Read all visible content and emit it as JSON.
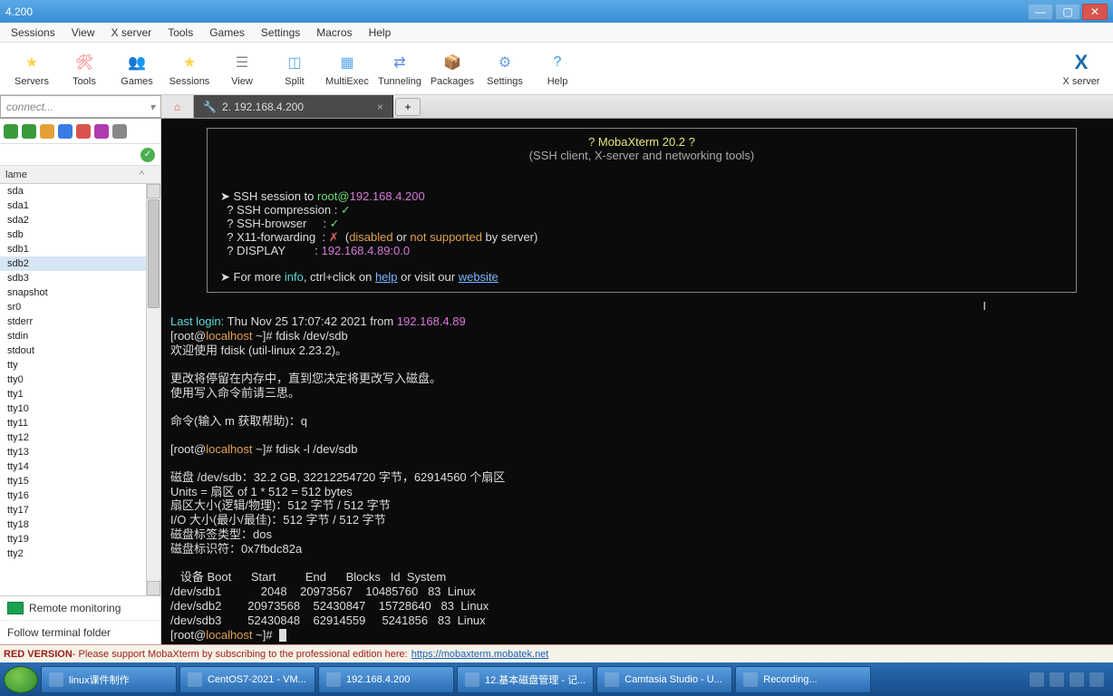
{
  "titlebar": {
    "title": "4.200"
  },
  "menubar": [
    "Sessions",
    "View",
    "X server",
    "Tools",
    "Games",
    "Settings",
    "Macros",
    "Help"
  ],
  "toolbar": [
    {
      "label": "Servers",
      "color": "#ffd24d",
      "glyph": "★"
    },
    {
      "label": "Tools",
      "color": "#ff5a5a",
      "glyph": "🛠"
    },
    {
      "label": "Games",
      "color": "#ffcf3a",
      "glyph": "👥"
    },
    {
      "label": "Sessions",
      "color": "#ffd24d",
      "glyph": "★"
    },
    {
      "label": "View",
      "color": "#8a8a8a",
      "glyph": "☰"
    },
    {
      "label": "Split",
      "color": "#5aa9e6",
      "glyph": "◫"
    },
    {
      "label": "MultiExec",
      "color": "#5aa9e6",
      "glyph": "▦"
    },
    {
      "label": "Tunneling",
      "color": "#5a8ae6",
      "glyph": "⇄"
    },
    {
      "label": "Packages",
      "color": "#c9a15a",
      "glyph": "📦"
    },
    {
      "label": "Settings",
      "color": "#6aa0e6",
      "glyph": "⚙"
    },
    {
      "label": "Help",
      "color": "#3a9be6",
      "glyph": "?"
    }
  ],
  "toolbar_right": {
    "label": "X server",
    "glyph": "✕"
  },
  "connect_placeholder": "connect...",
  "tabs": {
    "active": {
      "icon": "🔧",
      "label": "2. 192.168.4.200"
    },
    "add": "+"
  },
  "sidebar": {
    "header": "lame",
    "items": [
      "sda",
      "sda1",
      "sda2",
      "sdb",
      "sdb1",
      "sdb2",
      "sdb3",
      "snapshot",
      "sr0",
      "stderr",
      "stdin",
      "stdout",
      "tty",
      "tty0",
      "tty1",
      "tty10",
      "tty11",
      "tty12",
      "tty13",
      "tty14",
      "tty15",
      "tty16",
      "tty17",
      "tty18",
      "tty19",
      "tty2"
    ],
    "selected_index": 5,
    "remote_monitoring": "Remote monitoring",
    "follow": "Follow terminal folder"
  },
  "terminal": {
    "banner_title": "? MobaXterm 20.2 ?",
    "banner_sub": "(SSH client, X-server and networking tools)",
    "ssh_to_prefix": "➤ SSH session to ",
    "ssh_user": "root",
    "ssh_at": "@",
    "ssh_host": "192.168.4.200",
    "rows": [
      {
        "label": "SSH compression",
        "mark": "✓",
        "mark_color": "c-green"
      },
      {
        "label": "SSH-browser",
        "mark": "✓",
        "mark_color": "c-green"
      },
      {
        "label": "X11-forwarding",
        "mark": "✗",
        "mark_color": "c-red",
        "extra": "  (disabled or not supported by server)",
        "extra_parts": [
          [
            "(",
            ""
          ],
          [
            "disabled",
            "c-orange"
          ],
          [
            " or ",
            ""
          ],
          [
            "not supported",
            "c-orange"
          ],
          [
            " by server)",
            ""
          ]
        ]
      },
      {
        "label": "DISPLAY",
        "value": "192.168.4.89:0.0",
        "value_color": "c-magenta"
      }
    ],
    "more_prefix": "➤ For more ",
    "more_info": "info",
    "more_mid": ", ctrl+click on ",
    "more_help": "help",
    "more_or": " or visit our ",
    "more_site": "website",
    "last_login_label": "Last login:",
    "last_login_rest": " Thu Nov 25 17:07:42 2021 from ",
    "last_login_ip": "192.168.4.89",
    "prompt_open": "[root@",
    "prompt_host": "localhost",
    "prompt_close": " ~]#",
    "cmd1": " fdisk /dev/sdb",
    "line_welcome": "欢迎使用 fdisk (util-linux 2.23.2)。",
    "line_mem": "更改将停留在内存中，直到您决定将更改写入磁盘。",
    "line_think": "使用写入命令前请三思。",
    "line_cmdq": "命令(输入 m 获取帮助)：q",
    "cmd2": " fdisk -l /dev/sdb",
    "disk_line": "磁盘 /dev/sdb：32.2 GB, 32212254720 字节，62914560 个扇区",
    "units": "Units = 扇区 of 1 * 512 = 512 bytes",
    "sector": "扇区大小(逻辑/物理)：512 字节 / 512 字节",
    "io": "I/O 大小(最小/最佳)：512 字节 / 512 字节",
    "label_type": "磁盘标签类型：dos",
    "disk_id": "磁盘标识符：0x7fbdc82a",
    "table_header": "   设备 Boot      Start         End      Blocks   Id  System",
    "partitions": [
      "/dev/sdb1            2048    20973567    10485760   83  Linux",
      "/dev/sdb2        20973568    52430847    15728640   83  Linux",
      "/dev/sdb3        52430848    62914559     5241856   83  Linux"
    ]
  },
  "redbar": {
    "bold": "RED VERSION",
    "text": " - Please support MobaXterm by subscribing to the professional edition here: ",
    "link": "https://mobaxterm.mobatek.net"
  },
  "taskbar": {
    "items": [
      {
        "label": "linux课件制作"
      },
      {
        "label": "CentOS7-2021 - VM..."
      },
      {
        "label": "192.168.4.200"
      },
      {
        "label": "12.基本磁盘管理 - 记..."
      },
      {
        "label": "Camtasia Studio - U..."
      },
      {
        "label": "Recording..."
      }
    ]
  }
}
